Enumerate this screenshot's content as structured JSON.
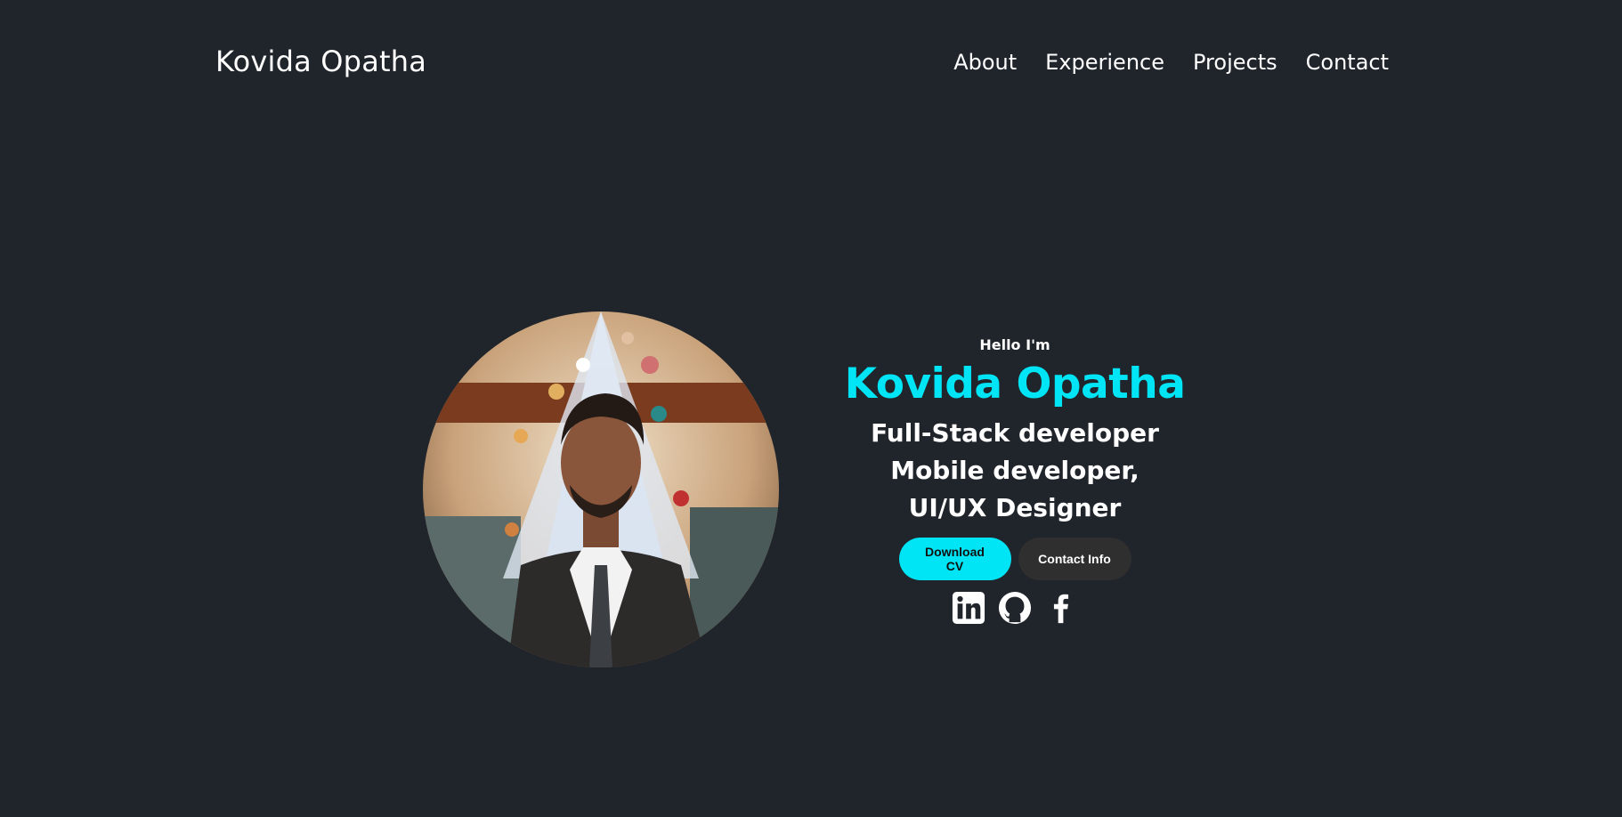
{
  "header": {
    "logo": "Kovida Opatha",
    "nav": [
      "About",
      "Experience",
      "Projects",
      "Contact"
    ]
  },
  "hero": {
    "greeting": "Hello I'm",
    "name": "Kovida Opatha",
    "roles": [
      "Full-Stack developer",
      "Mobile developer,",
      "UI/UX Designer"
    ],
    "buttons": {
      "download_cv": "Download CV",
      "contact_info": "Contact Info"
    },
    "socials": [
      "linkedin-icon",
      "github-icon",
      "facebook-icon"
    ]
  },
  "colors": {
    "background": "#20242b",
    "accent": "#00e5f6",
    "secondary_button": "#2f2f2f"
  }
}
